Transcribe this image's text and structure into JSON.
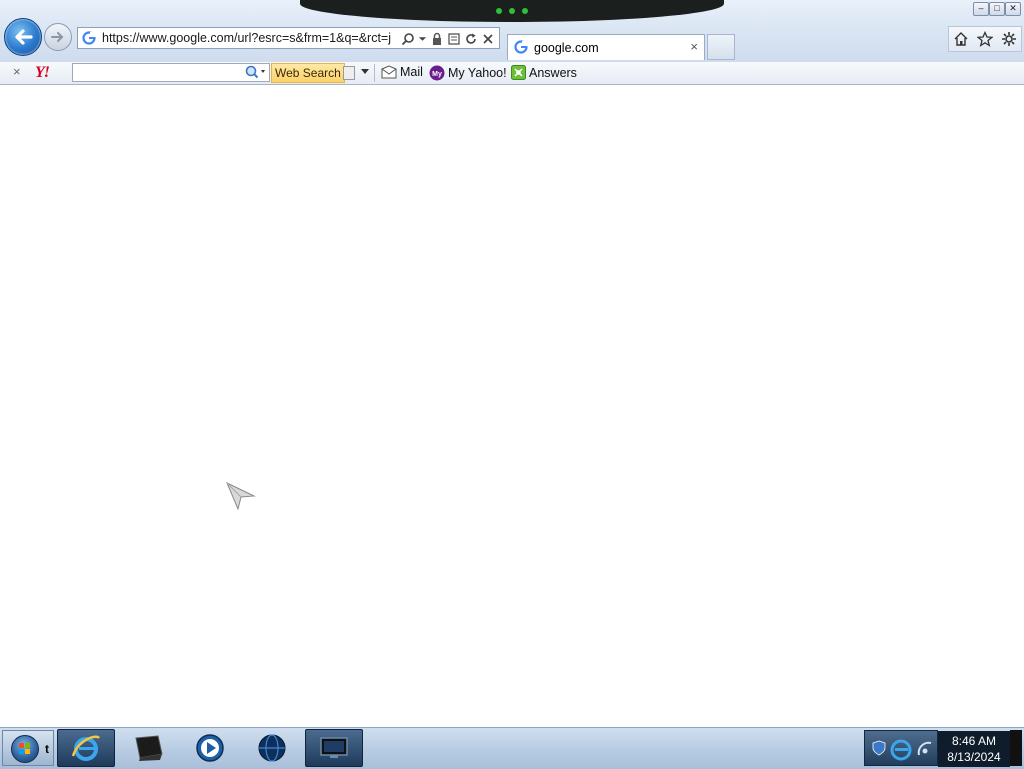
{
  "browser": {
    "address_url": "https://www.google.com/url?esrc=s&frm=1&q=&rct=j",
    "tab_title": "google.com",
    "tab_close": "×",
    "window_buttons": [
      "–",
      "□",
      "✕"
    ]
  },
  "yahoo_toolbar": {
    "close_label": "×",
    "logo_text": "Y!",
    "search_placeholder": "",
    "search_value": "",
    "search_button_label": "Web Search",
    "links": [
      {
        "label": "Mail",
        "icon": "mail-icon"
      },
      {
        "label": "My Yahoo!",
        "icon": "my-yahoo-icon"
      },
      {
        "label": "Answers",
        "icon": "answers-icon"
      }
    ]
  },
  "taskbar": {
    "start_label": "t",
    "items": [
      {
        "name": "internet-explorer",
        "active": true
      },
      {
        "name": "terminal-app",
        "active": false
      },
      {
        "name": "media-player",
        "active": false
      },
      {
        "name": "globe-app",
        "active": false
      },
      {
        "name": "monitor-app",
        "active": true
      }
    ],
    "clock_time": "8:46 AM",
    "clock_date": "8/13/2024"
  },
  "colors": {
    "chrome_bg": "#dbe6f4",
    "yahoo_red": "#d6001c",
    "web_search_yellow": "#fcd26a",
    "taskbar_bg": "#b9cde4"
  }
}
